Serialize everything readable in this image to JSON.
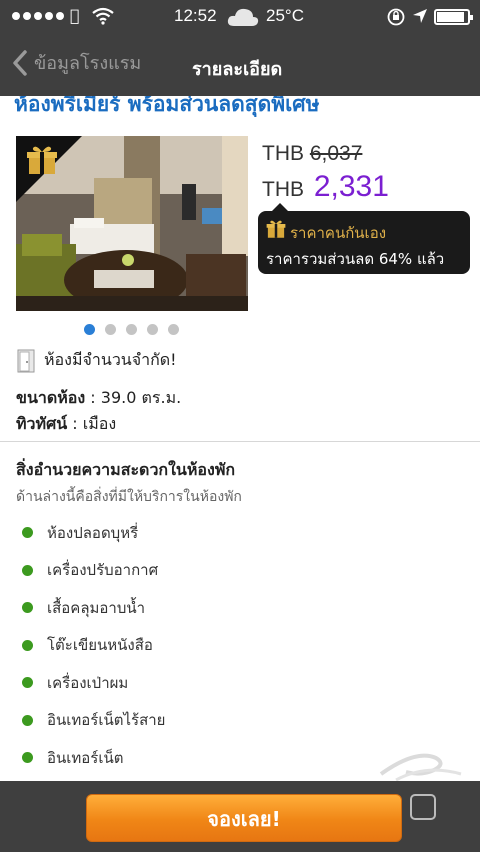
{
  "status_bar": {
    "time": "12:52",
    "temperature": "25°C",
    "battery_level": 0.9,
    "icons": [
      "signal-dots",
      "apple-icon",
      "wifi-icon",
      "cloud-icon",
      "rotation-lock-icon",
      "location-arrow-icon",
      "battery-icon"
    ]
  },
  "nav": {
    "back_label": "ข้อมูลโรงแรม",
    "title": "รายละเอียด"
  },
  "room": {
    "title": "ห้องพรีเมียร์ พร้อมส่วนลดสุดพิเศษ",
    "price_currency": "THB",
    "old_price": "6,037",
    "new_price": "2,331",
    "promo_label": "ราคาคนกันเอง",
    "promo_desc": "ราคารวมส่วนลด 64% แล้ว",
    "photo_dots": 5,
    "active_dot": 0
  },
  "details": {
    "limited_text": "ห้องมีจำนวนจำกัด!",
    "size_label": "ขนาดห้อง",
    "size_value": " : 39.0 ตร.ม.",
    "view_label": "ทิวทัศน์",
    "view_value": " : เมือง"
  },
  "amenities": {
    "title": "สิ่งอำนวยความสะดวกในห้องพัก",
    "subtitle": "ด้านล่างนี้คือสิ่งที่มีให้บริการในห้องพัก",
    "items": [
      "ห้องปลอดบุหรี่",
      "เครื่องปรับอากาศ",
      "เสื้อคลุมอาบน้ำ",
      "โต๊ะเขียนหนังสือ",
      "เครื่องเป่าผม",
      "อินเทอร์เน็ตไร้สาย",
      "อินเทอร์เน็ต"
    ]
  },
  "footer": {
    "book_label": "จองเลย!"
  },
  "colors": {
    "bar": "#3f3f3f",
    "title_blue": "#1a6cc0",
    "price_purple": "#7b1fd1",
    "promo_gold": "#e0b14a",
    "bullet_green": "#3c9a1f",
    "button_orange": "#f08616"
  }
}
